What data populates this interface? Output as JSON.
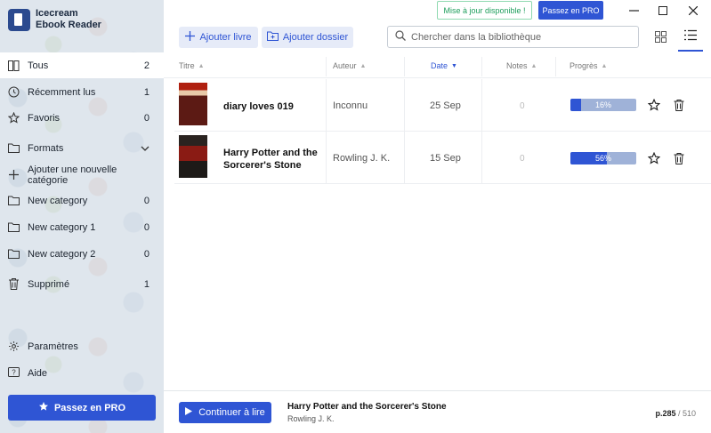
{
  "app": {
    "name_line1": "Icecream",
    "name_line2": "Ebook Reader"
  },
  "topbar": {
    "update_label": "Mise à jour disponible !",
    "pro_label": "Passez en PRO"
  },
  "sidebar": {
    "items": [
      {
        "label": "Tous",
        "count": "2"
      },
      {
        "label": "Récemment lus",
        "count": "1"
      },
      {
        "label": "Favoris",
        "count": "0"
      },
      {
        "label": "Formats"
      },
      {
        "label": "Ajouter une nouvelle catégorie"
      },
      {
        "label": "New category",
        "count": "0"
      },
      {
        "label": "New category 1",
        "count": "0"
      },
      {
        "label": "New category 2",
        "count": "0"
      },
      {
        "label": "Supprimé",
        "count": "1"
      },
      {
        "label": "Paramètres"
      },
      {
        "label": "Aide"
      }
    ],
    "pro_label": "Passez en PRO"
  },
  "toolbar": {
    "add_book_label": "Ajouter livre",
    "add_folder_label": "Ajouter dossier",
    "search_placeholder": "Chercher dans la bibliothèque"
  },
  "table": {
    "columns": {
      "title": "Titre",
      "author": "Auteur",
      "date": "Date",
      "notes": "Notes",
      "progress": "Progrès"
    },
    "rows": [
      {
        "title": "diary loves 019",
        "author": "Inconnu",
        "date": "25 Sep",
        "notes": "0",
        "progress_label": "16%",
        "progress": 16
      },
      {
        "title": "Harry Potter and the Sorcerer's Stone",
        "author": "Rowling J. K.",
        "date": "15 Sep",
        "notes": "0",
        "progress_label": "56%",
        "progress": 56
      }
    ]
  },
  "bottombar": {
    "continue_label": "Continuer à lire",
    "book_title": "Harry Potter and the Sorcerer's Stone",
    "book_author": "Rowling J. K.",
    "page_current": "p.285",
    "page_total": " / 510"
  },
  "colors": {
    "accent": "#2f55d4",
    "update_green": "#1e9e5c",
    "sidebar_bg": "#dfe6ed"
  }
}
